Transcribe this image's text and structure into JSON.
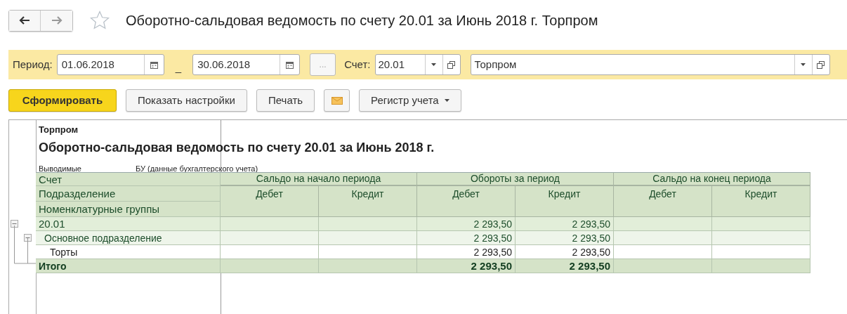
{
  "window": {
    "title": "Оборотно-сальдовая ведомость по счету 20.01 за Июнь 2018 г. Торпром",
    "favorite": false
  },
  "filter": {
    "period_label": "Период:",
    "date_from": "01.06.2018",
    "dash": "_",
    "date_to": "30.06.2018",
    "more_button": "...",
    "account_label": "Счет:",
    "account": "20.01",
    "organization": "Торпром"
  },
  "toolbar": [
    {
      "kind": "primary",
      "label": "Сформировать"
    },
    {
      "kind": "normal",
      "label": "Показать настройки"
    },
    {
      "kind": "normal",
      "label": "Печать"
    },
    {
      "kind": "mail"
    },
    {
      "kind": "menu",
      "label": "Регистр учета"
    }
  ],
  "report": {
    "organization": "Торпром",
    "title": "Оборотно-сальдовая ведомость по счету 20.01 за Июнь 2018 г.",
    "param_label": "Выводимые",
    "param_value": "БУ (данные бухгалтерского учета)",
    "row_headers": [
      "Счет",
      "Подразделение",
      "Номенклатурные группы"
    ],
    "column_groups": [
      {
        "label": "Сальдо на начало периода",
        "columns": [
          "Дебет",
          "Кредит"
        ]
      },
      {
        "label": "Обороты за период",
        "columns": [
          "Дебет",
          "Кредит"
        ]
      },
      {
        "label": "Сальдо на конец периода",
        "columns": [
          "Дебет",
          "Кредит"
        ]
      }
    ],
    "rows": [
      {
        "label": "20.01",
        "expanded": true,
        "turnover_debit": "2 293,50",
        "turnover_credit": "2 293,50",
        "children": [
          {
            "label": "Основное подразделение",
            "expanded": true,
            "turnover_debit": "2 293,50",
            "turnover_credit": "2 293,50",
            "children": [
              {
                "label": "Торты",
                "turnover_debit": "2 293,50",
                "turnover_credit": "2 293,50"
              }
            ]
          }
        ]
      }
    ],
    "total": {
      "label": "Итого",
      "turnover_debit": "2 293,50",
      "turnover_credit": "2 293,50"
    }
  }
}
